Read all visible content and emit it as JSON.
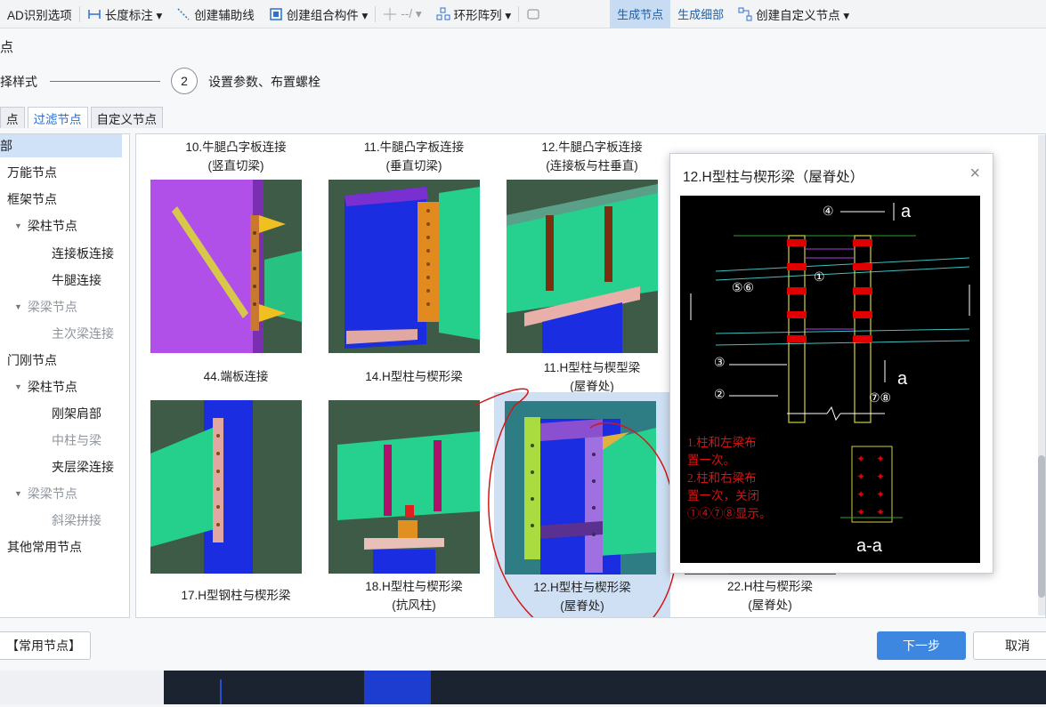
{
  "toolbar": {
    "items": [
      {
        "label": "AD识别选项"
      },
      {
        "label": "长度标注 ▾"
      },
      {
        "label": "创建辅助线"
      },
      {
        "label": "创建组合构件 ▾"
      },
      {
        "label": "--/ ▾"
      },
      {
        "label": "环形阵列 ▾"
      },
      {
        "label": "生成节点"
      },
      {
        "label": "生成细部"
      },
      {
        "label": "创建自定义节点 ▾"
      }
    ]
  },
  "dialog": {
    "title": "点",
    "step1": "择样式",
    "step2_number": "2",
    "step2": "设置参数、布置螺栓",
    "tabs": [
      "点",
      "过滤节点",
      "自定义节点"
    ]
  },
  "tree": [
    {
      "label": "部",
      "selected": true
    },
    {
      "label": "万能节点"
    },
    {
      "label": "框架节点"
    },
    {
      "label": "梁柱节点",
      "expanded": true
    },
    {
      "label": "连接板连接"
    },
    {
      "label": "牛腿连接"
    },
    {
      "label": "梁梁节点",
      "expanded": true,
      "dim": true
    },
    {
      "label": "主次梁连接",
      "dim": true
    },
    {
      "label": "门刚节点"
    },
    {
      "label": "梁柱节点",
      "expanded": true
    },
    {
      "label": "刚架肩部"
    },
    {
      "label": "中柱与梁",
      "dim": true
    },
    {
      "label": "夹层梁连接"
    },
    {
      "label": "梁梁节点",
      "expanded": true,
      "dim": true
    },
    {
      "label": "斜梁拼接",
      "dim": true
    },
    {
      "label": "其他常用节点"
    }
  ],
  "cards": [
    {
      "line1": "10.牛腿凸字板连接",
      "line2": "(竖直切梁)"
    },
    {
      "line1": "11.牛腿凸字板连接",
      "line2": "(垂直切梁)"
    },
    {
      "line1": "12.牛腿凸字板连接",
      "line2": "(连接板与柱垂直)"
    },
    {
      "line1": "44.端板连接",
      "line2": ""
    },
    {
      "line1": "14.H型柱与楔形梁",
      "line2": ""
    },
    {
      "line1": "11.H型柱与楔型梁",
      "line2": "(屋脊处)"
    },
    {
      "line1": "17.H型钢柱与楔形梁",
      "line2": ""
    },
    {
      "line1": "18.H型柱与楔形梁",
      "line2": "(抗风柱)"
    },
    {
      "line1": "12.H型柱与楔形梁",
      "line2": "(屋脊处)"
    },
    {
      "line1": "22.H柱与楔形梁",
      "line2": "(屋脊处)"
    }
  ],
  "popup": {
    "title": "12.H型柱与楔形梁（屋脊处）",
    "close": "×",
    "drawing": {
      "label_a1": "a",
      "label_a2": "a",
      "label_aa": "a-a",
      "marker_4": "④",
      "marker_1": "①",
      "marker_56": "⑤⑥",
      "marker_3": "③",
      "marker_2": "②",
      "marker_78": "⑦⑧",
      "note_lines": [
        "1.柱和左梁布",
        "置一次。",
        "2.柱和右梁布",
        "置一次，关闭",
        "①④⑦⑧显示。"
      ]
    }
  },
  "buttons": {
    "common": "【常用节点】",
    "next": "下一步",
    "cancel": "取消"
  },
  "colors": {
    "accent": "#3d87e0",
    "selection": "#cfe2f8",
    "annotation_red": "#d01818"
  }
}
